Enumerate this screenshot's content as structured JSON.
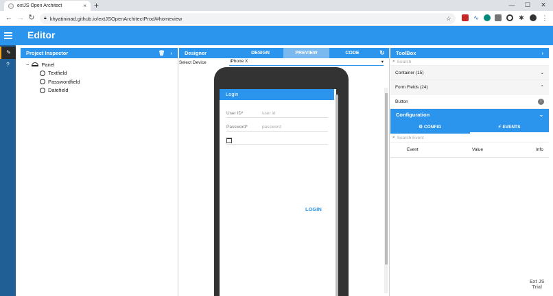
{
  "browser": {
    "tab_title": "extJS Open Architect",
    "tab_close": "×",
    "new_tab": "+",
    "minimize": "—",
    "maximize": "☐",
    "close": "✕",
    "url": "khyatininad.github.io/extJSOpenArchitectProd/#homeview"
  },
  "app": {
    "title": "Editor",
    "watermark_line1": "Ext JS",
    "watermark_line2": "Trial"
  },
  "inspector": {
    "title": "Project Inspector",
    "tree_root": "Panel",
    "tree_root_toggle": "−",
    "tree_items": [
      "Textfield",
      "Passwordfield",
      "Datefield"
    ]
  },
  "designer": {
    "title": "Designer",
    "tabs": [
      "DESIGN",
      "PREVIEW",
      "CODE"
    ],
    "active_tab": "PREVIEW",
    "select_device_label": "Select Device",
    "device": "iPhone X"
  },
  "preview": {
    "header": "Login",
    "userid_label": "User ID*",
    "userid_placeholder": "user id",
    "password_label": "Password*",
    "password_placeholder": "password",
    "button": "LOGIN"
  },
  "toolbox": {
    "title": "ToolBox",
    "search_placeholder": "Search",
    "groups": [
      {
        "label": "Container (15)",
        "toggle": "⌄"
      },
      {
        "label": "Form Fields (24)",
        "toggle": "⌃"
      }
    ],
    "item": "Button"
  },
  "configuration": {
    "title": "Configuration",
    "tabs": [
      "CONFIG",
      "EVENTS"
    ],
    "active_tab": "EVENTS",
    "search_placeholder": "Search Event",
    "columns": [
      "Event",
      "Value",
      "Info"
    ]
  },
  "colors": {
    "accent": "#2b94ed",
    "rail": "#1f5f95",
    "tab_active": "#7ab8f0"
  }
}
